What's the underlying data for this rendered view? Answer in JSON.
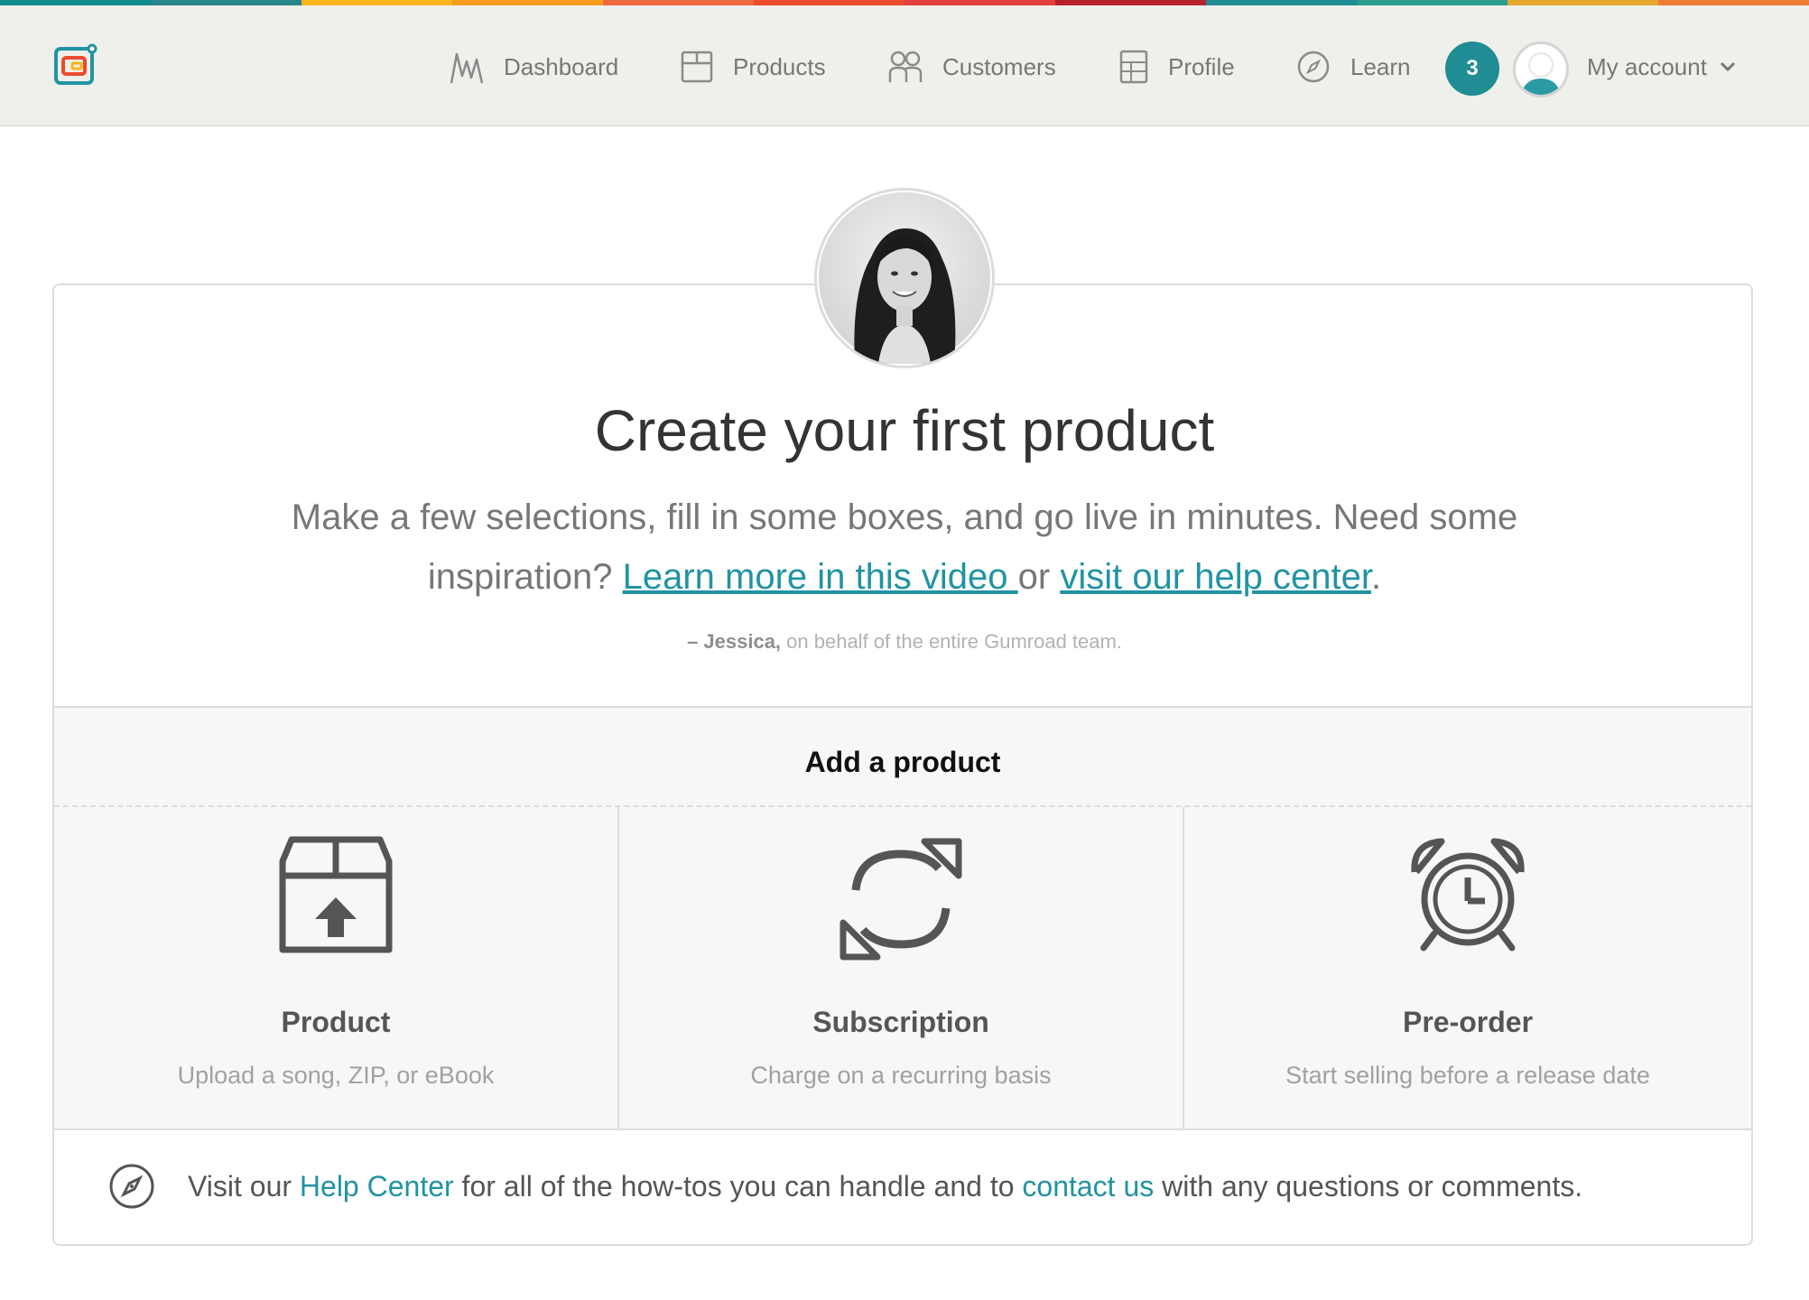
{
  "brand": {
    "stripe_colors": [
      "#0f8b8d",
      "#26868a",
      "#f9b51d",
      "#f79d1d",
      "#f0683f",
      "#ec4b2e",
      "#e33e3e",
      "#b4232f",
      "#1f8d93",
      "#2a9d8f",
      "#e6a72e",
      "#ee7c30"
    ],
    "accent": "#2193a3"
  },
  "nav": {
    "items": [
      {
        "label": "Dashboard",
        "icon": "dashboard-icon"
      },
      {
        "label": "Products",
        "icon": "products-icon"
      },
      {
        "label": "Customers",
        "icon": "customers-icon"
      },
      {
        "label": "Profile",
        "icon": "profile-icon"
      },
      {
        "label": "Learn",
        "icon": "compass-icon"
      }
    ],
    "notification_count": "3",
    "account_label": "My account"
  },
  "onboarding": {
    "heading": "Create your first product",
    "intro_text_1": "Make a few selections, fill in some boxes, and go live in minutes. Need some inspiration? ",
    "video_link": "Learn more in this video ",
    "intro_text_2": "or ",
    "help_link": "visit our help center",
    "intro_text_3": ".",
    "signature_name": "– Jessica,",
    "signature_rest": " on behalf of the entire Gumroad team."
  },
  "add_product": {
    "title": "Add a product",
    "options": [
      {
        "title": "Product",
        "description": "Upload a song, ZIP, or eBook",
        "icon": "box-upload-icon"
      },
      {
        "title": "Subscription",
        "description": "Charge on a recurring basis",
        "icon": "recurring-icon"
      },
      {
        "title": "Pre-order",
        "description": "Start selling before a release date",
        "icon": "alarm-clock-icon"
      }
    ]
  },
  "help": {
    "text_1": "Visit our ",
    "help_center_link": "Help Center",
    "text_2": " for all of the how-tos you can handle and to ",
    "contact_link": "contact us",
    "text_3": " with any questions or comments."
  }
}
